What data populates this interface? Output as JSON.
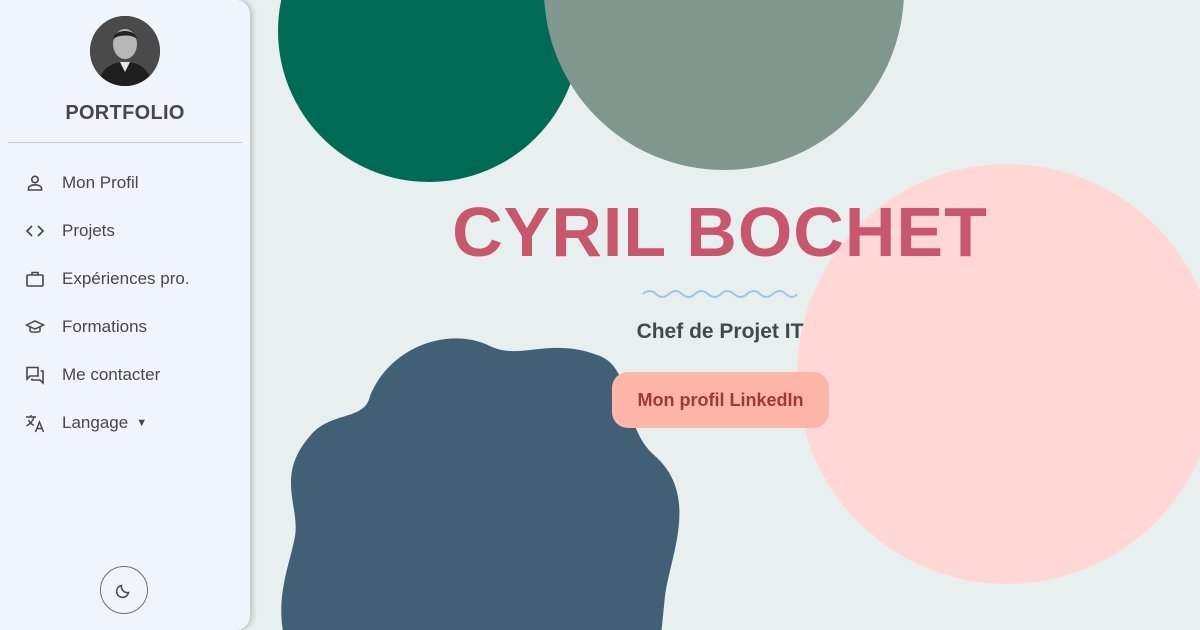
{
  "sidebar": {
    "brand": "PORTFOLIO",
    "items": [
      {
        "label": "Mon Profil",
        "icon": "person-icon"
      },
      {
        "label": "Projets",
        "icon": "code-icon"
      },
      {
        "label": "Expériences pro.",
        "icon": "briefcase-icon"
      },
      {
        "label": "Formations",
        "icon": "graduation-cap-icon"
      },
      {
        "label": "Me contacter",
        "icon": "chat-icon"
      },
      {
        "label": "Langage",
        "icon": "translate-icon"
      }
    ],
    "theme_toggle_icon": "moon-icon"
  },
  "hero": {
    "name": "CYRIL BOCHET",
    "role": "Chef de Projet IT",
    "cta_label": "Mon profil LinkedIn"
  },
  "colors": {
    "background": "#e8f0ef",
    "sidebar": "#f0f4fb",
    "name": "#c8566c",
    "cta_bg": "#ffb6a9",
    "cta_text": "#a0392e",
    "shape_green": "#006b54",
    "shape_sage": "#7f978d",
    "shape_pink": "#ffd8d5",
    "shape_slate": "#416075"
  }
}
